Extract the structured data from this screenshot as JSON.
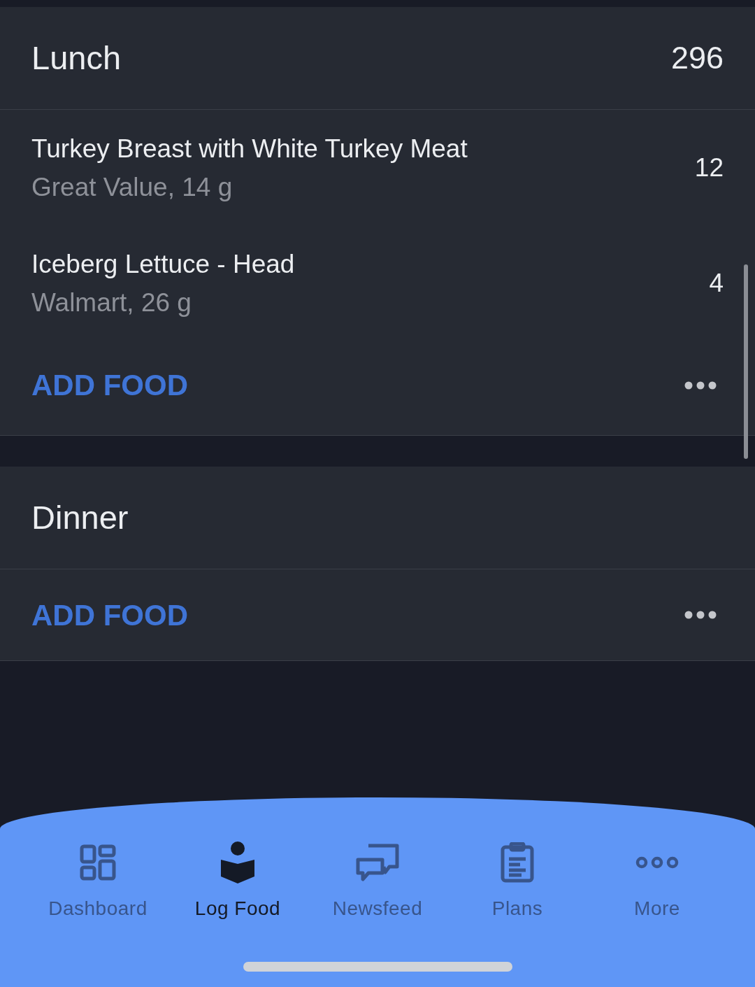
{
  "meals": [
    {
      "name": "Lunch",
      "total": "296",
      "foods": [
        {
          "name": "Turkey Breast with White Turkey Meat",
          "detail": "Great Value, 14 g",
          "calories": "12"
        },
        {
          "name": "Iceberg Lettuce - Head",
          "detail": "Walmart, 26 g",
          "calories": "4"
        }
      ],
      "add_label": "ADD FOOD"
    },
    {
      "name": "Dinner",
      "add_label": "ADD FOOD"
    }
  ],
  "tabs": [
    {
      "kind": "dashboard",
      "label": "Dashboard",
      "selected": false
    },
    {
      "kind": "log",
      "label": "Log Food",
      "selected": true
    },
    {
      "kind": "news",
      "label": "Newsfeed",
      "selected": false
    },
    {
      "kind": "plans",
      "label": "Plans",
      "selected": false
    },
    {
      "kind": "more",
      "label": "More",
      "selected": false
    }
  ]
}
